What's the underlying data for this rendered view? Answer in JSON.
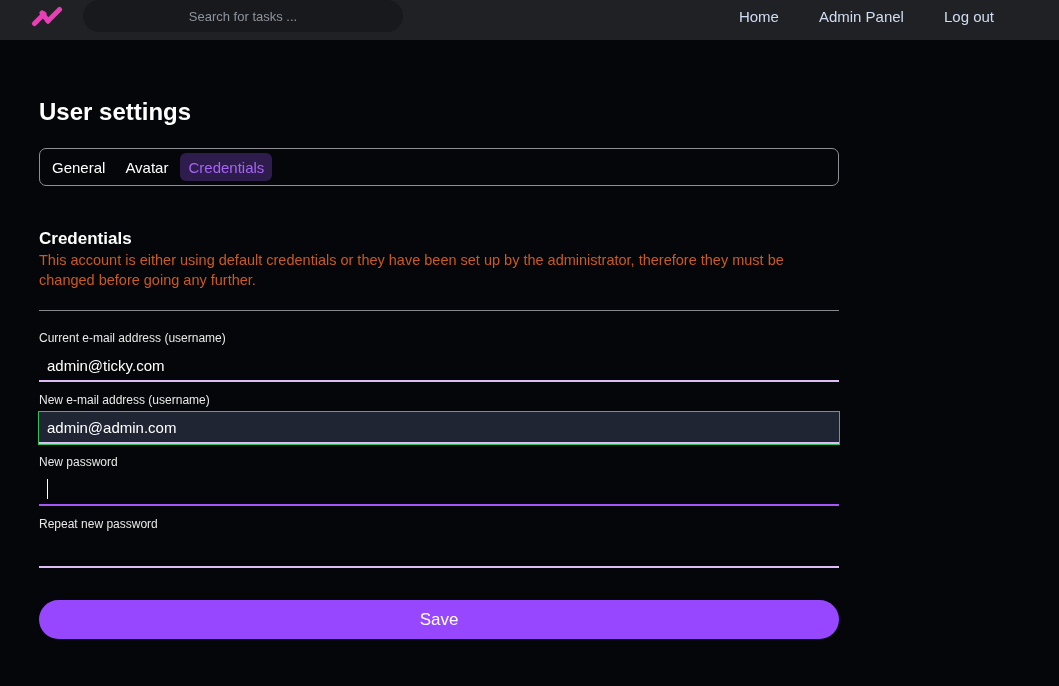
{
  "navbar": {
    "search": {
      "placeholder": "Search for tasks ..."
    },
    "links": [
      {
        "label": "Home"
      },
      {
        "label": "Admin Panel"
      },
      {
        "label": "Log out"
      }
    ]
  },
  "page": {
    "title": "User settings"
  },
  "tabs": [
    {
      "label": "General",
      "selected": false
    },
    {
      "label": "Avatar",
      "selected": false
    },
    {
      "label": "Credentials",
      "selected": true
    }
  ],
  "section": {
    "heading": "Credentials",
    "warning": "This account is either using default credentials or they have been set up by the administrator, therefore they must be changed before going any further."
  },
  "fields": [
    {
      "label": "Current e-mail address (username)",
      "value": "admin@ticky.com",
      "focused": false,
      "valid": false
    },
    {
      "label": "New e-mail address (username)",
      "value": "admin@admin.com",
      "focused": false,
      "valid": true
    },
    {
      "label": "New password",
      "focused": true,
      "valid": false
    },
    {
      "label": "Repeat new password",
      "focused": false,
      "valid": false
    }
  ],
  "save_button": {
    "label": "Save"
  }
}
